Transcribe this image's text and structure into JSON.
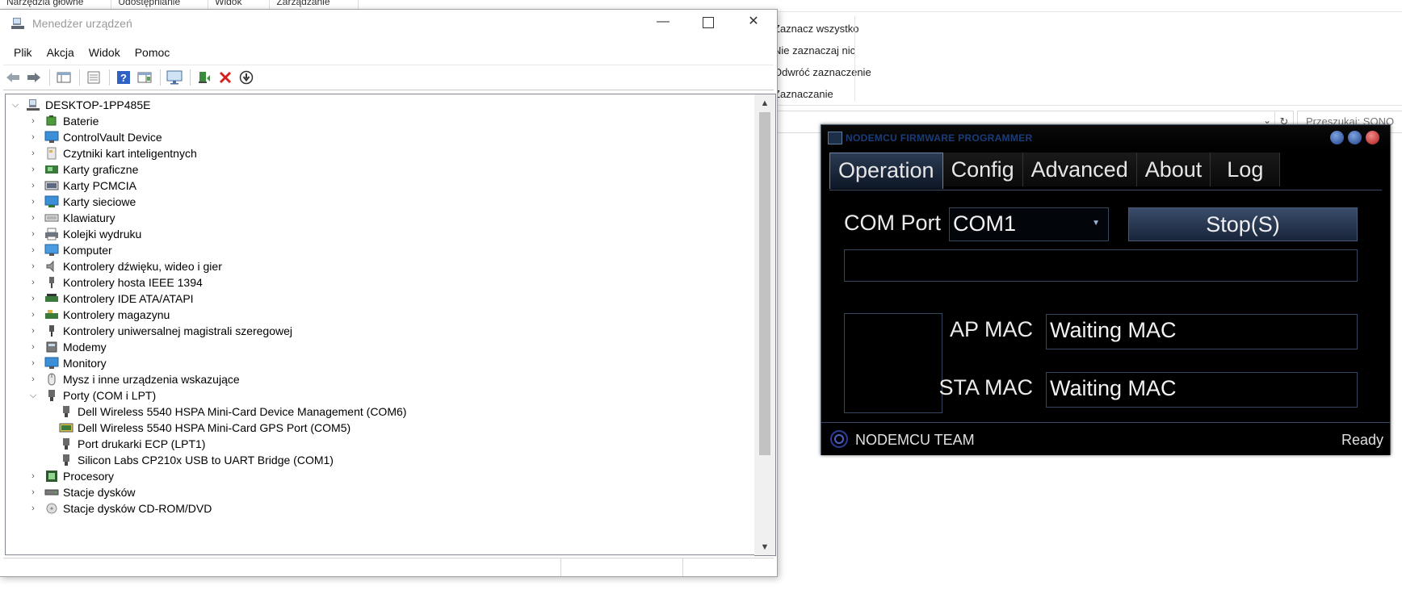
{
  "background_explorer": {
    "ribbon_tabs": [
      "Narzędzia główne",
      "Udostępnianie",
      "Widok",
      "Zarządzanie"
    ],
    "selection_group": [
      "Zaznacz wszystko",
      "Nie zaznaczaj nic",
      "Odwróć zaznaczenie",
      "Zaznaczanie"
    ],
    "search_placeholder": "Przeszukaj: SONO"
  },
  "device_manager": {
    "title": "Menedżer urządzeń",
    "window_buttons": {
      "minimize": "—",
      "close": "✕"
    },
    "menu": [
      "Plik",
      "Akcja",
      "Widok",
      "Pomoc"
    ],
    "toolbar_icons": [
      "back-arrow-icon",
      "forward-arrow-icon",
      "show-hide-console-tree-icon",
      "properties-icon",
      "help-icon",
      "action-pane-icon",
      "scan-hardware-icon",
      "update-driver-icon",
      "uninstall-icon",
      "disable-device-icon"
    ],
    "root": "DESKTOP-1PP485E",
    "categories": [
      {
        "label": "Baterie",
        "expanded": false,
        "icon": "battery-icon"
      },
      {
        "label": "ControlVault Device",
        "expanded": false,
        "icon": "monitor-icon"
      },
      {
        "label": "Czytniki kart inteligentnych",
        "expanded": false,
        "icon": "smartcard-reader-icon"
      },
      {
        "label": "Karty graficzne",
        "expanded": false,
        "icon": "display-adapter-icon"
      },
      {
        "label": "Karty PCMCIA",
        "expanded": false,
        "icon": "pcmcia-icon"
      },
      {
        "label": "Karty sieciowe",
        "expanded": false,
        "icon": "network-adapter-icon"
      },
      {
        "label": "Klawiatury",
        "expanded": false,
        "icon": "keyboard-icon"
      },
      {
        "label": "Kolejki wydruku",
        "expanded": false,
        "icon": "printer-icon"
      },
      {
        "label": "Komputer",
        "expanded": false,
        "icon": "computer-icon"
      },
      {
        "label": "Kontrolery dźwięku, wideo i gier",
        "expanded": false,
        "icon": "speaker-icon"
      },
      {
        "label": "Kontrolery hosta IEEE 1394",
        "expanded": false,
        "icon": "ieee1394-icon"
      },
      {
        "label": "Kontrolery IDE ATA/ATAPI",
        "expanded": false,
        "icon": "ide-controller-icon"
      },
      {
        "label": "Kontrolery magazynu",
        "expanded": false,
        "icon": "storage-controller-icon"
      },
      {
        "label": "Kontrolery uniwersalnej magistrali szeregowej",
        "expanded": false,
        "icon": "usb-icon"
      },
      {
        "label": "Modemy",
        "expanded": false,
        "icon": "modem-icon"
      },
      {
        "label": "Monitory",
        "expanded": false,
        "icon": "monitor-icon"
      },
      {
        "label": "Mysz i inne urządzenia wskazujące",
        "expanded": false,
        "icon": "mouse-icon"
      },
      {
        "label": "Porty (COM i LPT)",
        "expanded": true,
        "icon": "port-icon"
      },
      {
        "label": "Procesory",
        "expanded": false,
        "icon": "processor-icon"
      },
      {
        "label": "Stacje dysków",
        "expanded": false,
        "icon": "disk-drive-icon"
      },
      {
        "label": "Stacje dysków CD-ROM/DVD",
        "expanded": false,
        "icon": "cdrom-icon"
      }
    ],
    "ports_children": [
      "Dell Wireless 5540 HSPA Mini-Card Device Management (COM6)",
      "Dell Wireless 5540 HSPA Mini-Card GPS Port (COM5)",
      "Port drukarki ECP (LPT1)",
      "Silicon Labs CP210x USB to UART Bridge (COM1)"
    ]
  },
  "nodemcu": {
    "title": "NODEMCU FIRMWARE PROGRAMMER",
    "tabs": [
      "Operation",
      "Config",
      "Advanced",
      "About",
      "Log"
    ],
    "active_tab": "Operation",
    "com_port_label": "COM Port",
    "com_port_value": "COM1",
    "stop_button": "Stop(S)",
    "ap_mac_label": "AP MAC",
    "ap_mac_value": "Waiting MAC",
    "sta_mac_label": "STA MAC",
    "sta_mac_value": "Waiting MAC",
    "team": "NODEMCU TEAM",
    "status": "Ready",
    "colors": {
      "background": "#000000",
      "accent": "#3a4d6a",
      "title": "#1a3c7a"
    }
  }
}
